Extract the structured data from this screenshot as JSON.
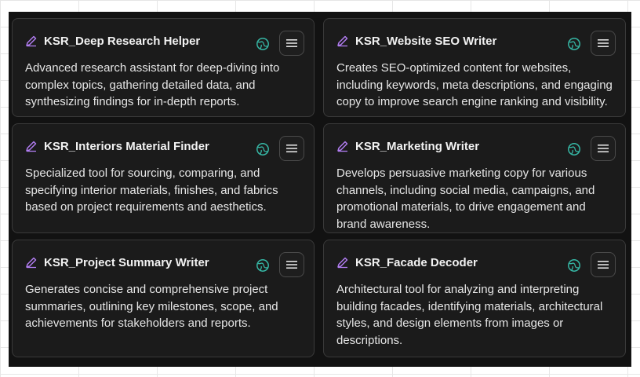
{
  "colors": {
    "accent_pencil": "#b07cf0",
    "globe": "#36b7a5",
    "panel_bg": "#121212",
    "card_bg": "#1b1b1b"
  },
  "icons": {
    "edit": "pencil-icon",
    "public": "globe-icon",
    "menu": "hamburger-menu-icon"
  },
  "cards": [
    {
      "title": "KSR_Deep Research Helper",
      "description": "Advanced research assistant for deep-diving into complex topics, gathering detailed data, and synthesizing findings for in-depth reports."
    },
    {
      "title": "KSR_Website SEO Writer",
      "description": "Creates SEO-optimized content for websites, including keywords, meta descriptions, and engaging copy to improve search engine ranking and visibility."
    },
    {
      "title": "KSR_Interiors Material Finder",
      "description": "Specialized tool for sourcing, comparing, and specifying interior materials, finishes, and fabrics based on project requirements and aesthetics."
    },
    {
      "title": "KSR_Marketing Writer",
      "description": "Develops persuasive marketing copy for various channels, including social media, campaigns, and promotional materials, to drive engagement and brand awareness."
    },
    {
      "title": "KSR_Project Summary Writer",
      "description": "Generates concise and comprehensive project summaries, outlining key milestones, scope, and achievements for stakeholders and reports."
    },
    {
      "title": "KSR_Facade Decoder",
      "description": "Architectural tool for analyzing and interpreting building facades, identifying materials, architectural styles, and design elements from images or descriptions."
    }
  ]
}
